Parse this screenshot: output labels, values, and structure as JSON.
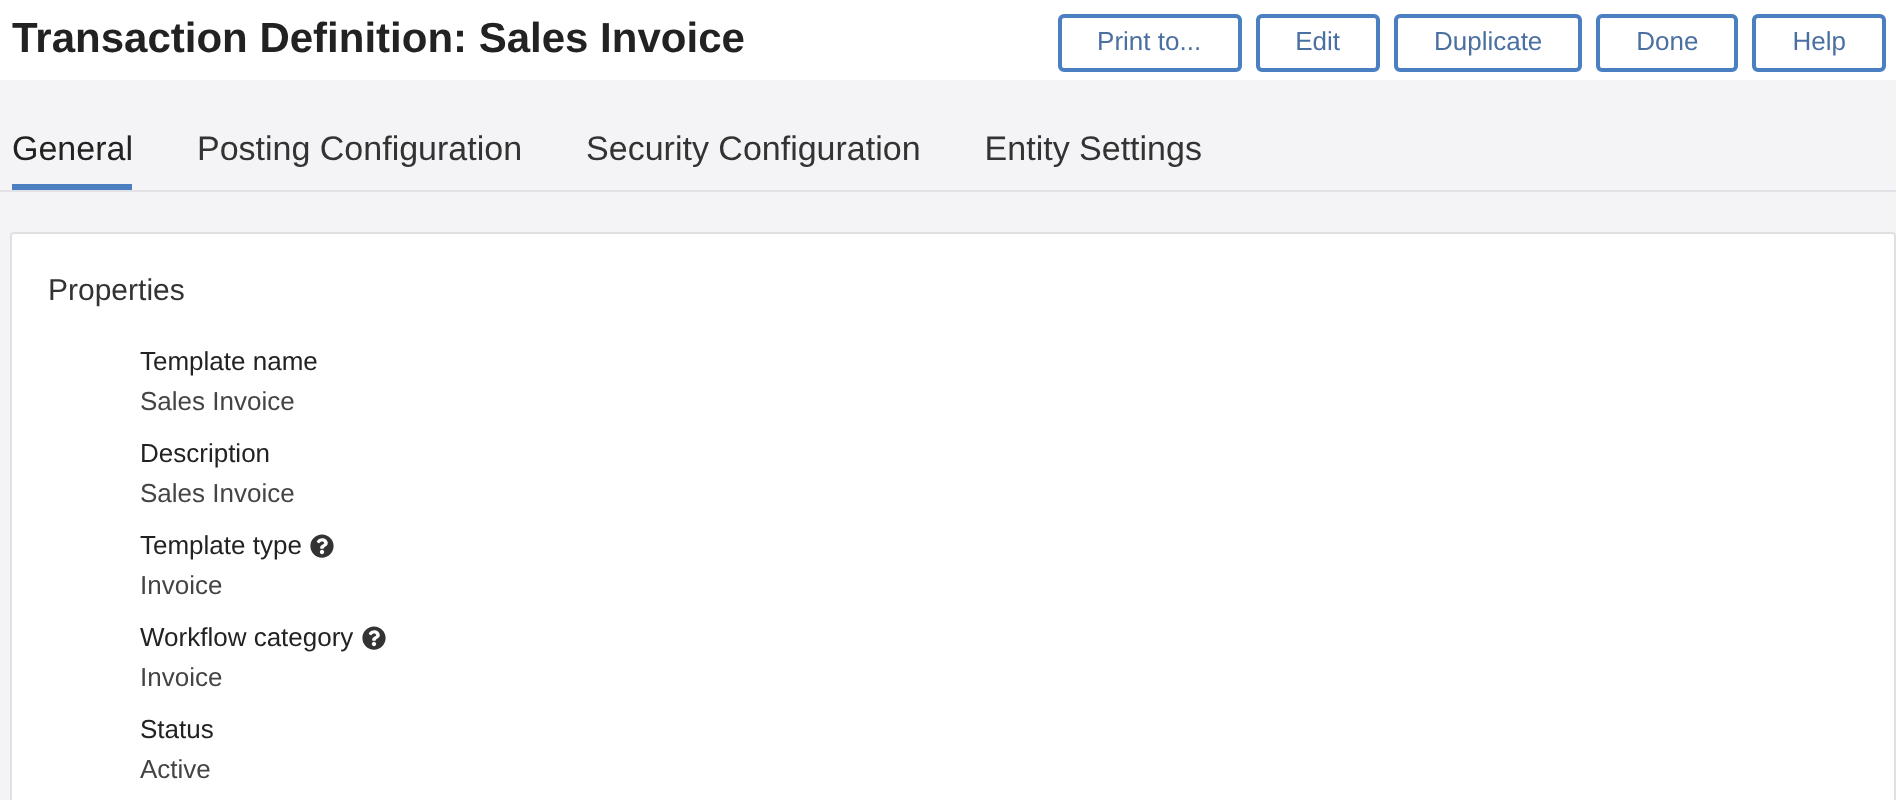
{
  "title": "Transaction Definition: Sales Invoice",
  "buttons": [
    "Print to...",
    "Edit",
    "Duplicate",
    "Done",
    "Help"
  ],
  "tabs": [
    {
      "label": "General",
      "selected": true
    },
    {
      "label": "Posting Configuration",
      "selected": false
    },
    {
      "label": "Security Configuration",
      "selected": false
    },
    {
      "label": "Entity Settings",
      "selected": false
    }
  ],
  "section": {
    "title": "Properties",
    "fields": [
      {
        "label": "Template name",
        "value": "Sales Invoice",
        "help": false
      },
      {
        "label": "Description",
        "value": "Sales Invoice",
        "help": false
      },
      {
        "label": "Template type",
        "value": "Invoice",
        "help": true
      },
      {
        "label": "Workflow category",
        "value": "Invoice",
        "help": true
      },
      {
        "label": "Status",
        "value": "Active",
        "help": false
      }
    ]
  }
}
